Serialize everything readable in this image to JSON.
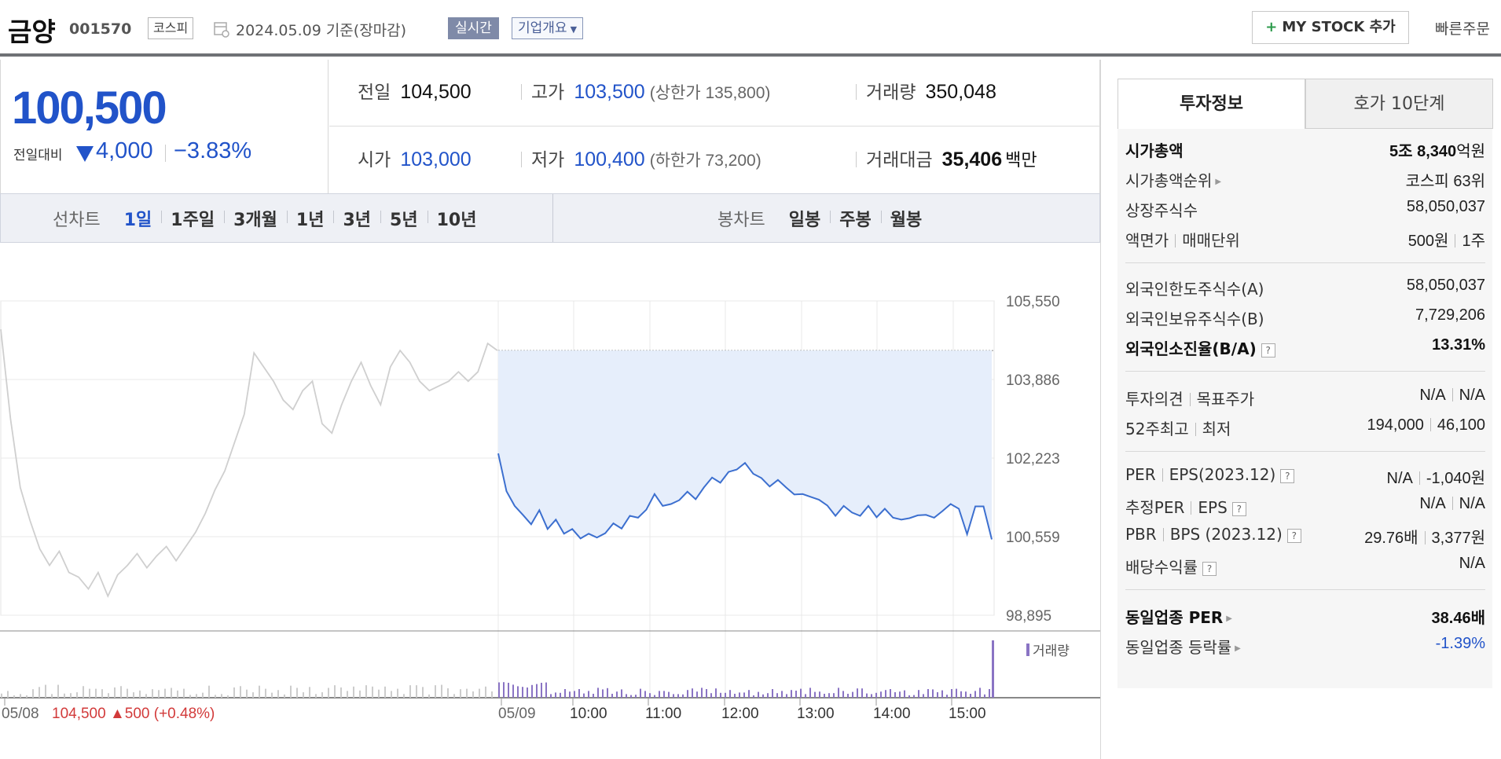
{
  "header": {
    "stock_name": "금양",
    "stock_code": "001570",
    "market": "코스피",
    "date": "2024.05.09 기준(장마감)",
    "realtime_label": "실시간",
    "company_label": "기업개요",
    "mystock_label": "MY STOCK 추가",
    "quick_order": "빠른주문"
  },
  "price": {
    "current": "100,500",
    "compare_label": "전일대비",
    "change": "4,000",
    "change_rate": "−3.83%",
    "direction": "down",
    "color": "#2153c9"
  },
  "stats": {
    "prev_close_label": "전일",
    "prev_close": "104,500",
    "high_label": "고가",
    "high": "103,500",
    "upper_limit": "(상한가 135,800)",
    "volume_label": "거래량",
    "volume": "350,048",
    "open_label": "시가",
    "open": "103,000",
    "low_label": "저가",
    "low": "100,400",
    "lower_limit": "(하한가 73,200)",
    "amount_label": "거래대금",
    "amount": "35,406",
    "amount_unit": "백만"
  },
  "chart_tabs": {
    "line_title": "선차트",
    "line_periods": [
      "1일",
      "1주일",
      "3개월",
      "1년",
      "3년",
      "5년",
      "10년"
    ],
    "active_period": "1일",
    "candle_title": "봉차트",
    "candle_periods": [
      "일봉",
      "주봉",
      "월봉"
    ]
  },
  "chart_data": {
    "type": "line",
    "title": "",
    "xlabel": "",
    "ylabel": "",
    "ylim": [
      98895,
      105550
    ],
    "y_ticks": [
      "105,550",
      "103,886",
      "102,223",
      "100,559",
      "98,895"
    ],
    "x_ticks": [
      "05/08",
      "05/09",
      "10:00",
      "11:00",
      "12:00",
      "13:00",
      "14:00",
      "15:00"
    ],
    "prev_close": 104500,
    "prev_day_label": "05/08",
    "prev_day_close": "104,500",
    "prev_day_change": "▲500",
    "prev_day_rate": "(+0.48%)",
    "volume_legend": "거래량",
    "series": [
      {
        "name": "05/08",
        "color": "#cfcfcf",
        "values": [
          104950,
          103050,
          101600,
          100900,
          100300,
          99950,
          100250,
          99800,
          99700,
          99450,
          99800,
          99300,
          99750,
          99950,
          100200,
          99900,
          100150,
          100350,
          100050,
          100350,
          100650,
          101050,
          101550,
          101950,
          102550,
          103150,
          104450,
          104150,
          103850,
          103450,
          103250,
          103650,
          103850,
          102950,
          102750,
          103350,
          103850,
          104250,
          103750,
          103350,
          104150,
          104500,
          104250,
          103850,
          103650,
          103750,
          103850,
          104050,
          103850,
          104050,
          104650,
          104500
        ]
      },
      {
        "name": "05/09",
        "color": "#3c6fcf",
        "values": [
          102320,
          101520,
          101210,
          101020,
          100820,
          101120,
          100720,
          100920,
          100620,
          100720,
          100520,
          100620,
          100540,
          100630,
          100840,
          100730,
          101000,
          100960,
          101130,
          101460,
          101210,
          101250,
          101330,
          101510,
          101350,
          101600,
          101810,
          101700,
          101930,
          101980,
          102120,
          101890,
          101800,
          101620,
          101760,
          101600,
          101450,
          101460,
          101400,
          101340,
          101220,
          101000,
          101210,
          101070,
          101000,
          101210,
          100970,
          101150,
          100960,
          100920,
          100950,
          101010,
          101020,
          100960,
          101100,
          101250,
          101150,
          100610,
          101200,
          101200,
          100500
        ]
      }
    ]
  },
  "right": {
    "tab_active": "투자정보",
    "tab_inactive": "호가 10단계",
    "market_cap_label": "시가총액",
    "market_cap_a": "5조 8,340",
    "market_cap_b": "억원",
    "cap_rank_label": "시가총액순위",
    "cap_rank": "코스피 63위",
    "shares_label": "상장주식수",
    "shares": "58,050,037",
    "face_label": "액면가",
    "trade_unit_label": "매매단위",
    "face_value": "500원",
    "trade_unit": "1주",
    "foreign_limit_label": "외국인한도주식수(A)",
    "foreign_limit": "58,050,037",
    "foreign_hold_label": "외국인보유주식수(B)",
    "foreign_hold": "7,729,206",
    "foreign_rate_label": "외국인소진율(B/A)",
    "foreign_rate": "13.31%",
    "opinion_label": "투자의견",
    "target_label": "목표주가",
    "opinion": "N/A",
    "target": "N/A",
    "w52_high_label": "52주최고",
    "w52_low_label": "최저",
    "w52_high": "194,000",
    "w52_low": "46,100",
    "per_label": "PER",
    "eps_label": "EPS(2023.12)",
    "per": "N/A",
    "eps": "-1,040원",
    "est_per_label": "추정PER",
    "est_eps_label": "EPS",
    "est_per": "N/A",
    "est_eps": "N/A",
    "pbr_label": "PBR",
    "bps_label": "BPS (2023.12)",
    "pbr": "29.76배",
    "bps": "3,377원",
    "dividend_label": "배당수익률",
    "dividend": "N/A",
    "sector_per_label": "동일업종 PER",
    "sector_per": "38.46배",
    "sector_rate_label": "동일업종 등락률",
    "sector_rate": "-1.39%",
    "help_glyph": "?"
  }
}
